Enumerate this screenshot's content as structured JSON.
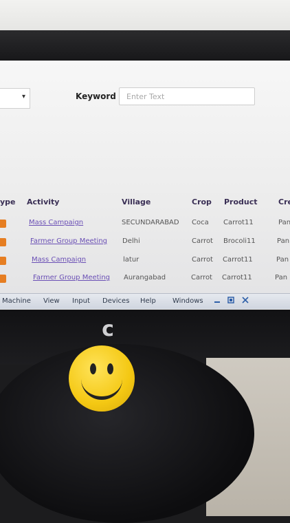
{
  "filters": {
    "select_arrow": "▾",
    "keyword_label": "Keyword",
    "keyword_placeholder": "Enter Text"
  },
  "table": {
    "columns": [
      "ype",
      "Activity",
      "Village",
      "Crop",
      "Product",
      "Cre"
    ],
    "rows": [
      {
        "activity": "Mass Campaign",
        "village": "SECUNDARABAD",
        "crop": "Coca",
        "product": "Carrot11",
        "extra": "Pan"
      },
      {
        "activity": "Farmer Group Meeting",
        "village": "Delhi",
        "crop": "Carrot",
        "product": "Brocoli11",
        "extra": "Pan"
      },
      {
        "activity": "Mass Campaign",
        "village": "latur",
        "crop": "Carrot",
        "product": "Carrot11",
        "extra": "Pan"
      },
      {
        "activity": "Farmer Group Meeting",
        "village": "Aurangabad",
        "crop": "Carrot",
        "product": "Carrot11",
        "extra": "Pan"
      }
    ]
  },
  "vm_menu": {
    "items": [
      "Machine",
      "View",
      "Input",
      "Devices",
      "Help"
    ],
    "windows_label": "Windows"
  },
  "brand_logo": "c",
  "colors": {
    "activity_link": "#6a4fb5",
    "row_icon": "#e67e22",
    "header_text": "#3a2f55"
  }
}
